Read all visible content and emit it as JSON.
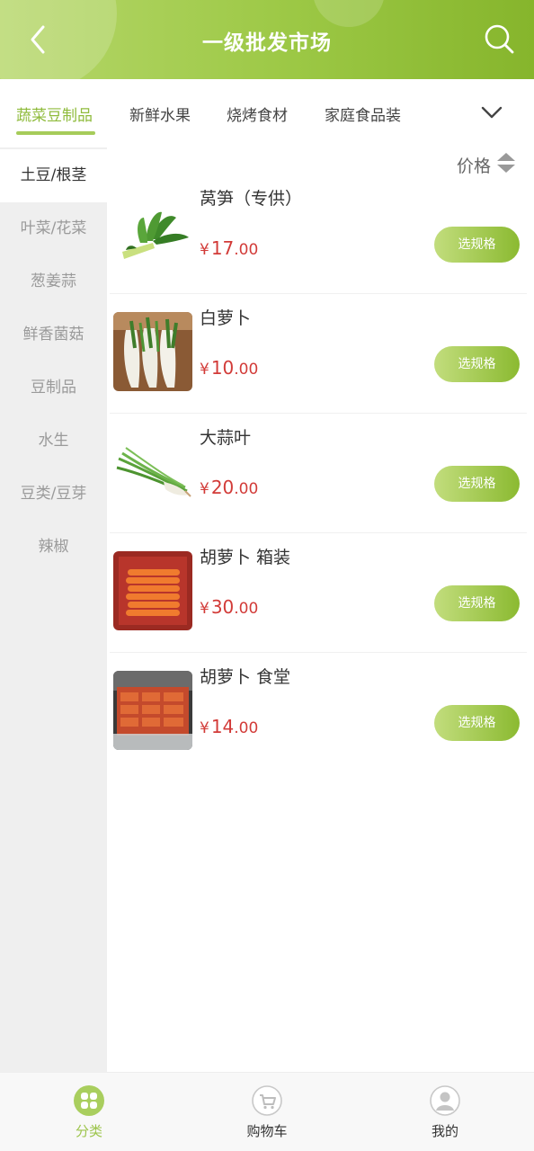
{
  "header": {
    "title": "一级批发市场"
  },
  "category_tabs": [
    {
      "label": "蔬菜豆制品",
      "active": true
    },
    {
      "label": "新鲜水果",
      "active": false
    },
    {
      "label": "烧烤食材",
      "active": false
    },
    {
      "label": "家庭食品装",
      "active": false
    }
  ],
  "sidebar": {
    "items": [
      {
        "label": "土豆/根茎",
        "active": true
      },
      {
        "label": "叶菜/花菜",
        "active": false
      },
      {
        "label": "葱姜蒜",
        "active": false
      },
      {
        "label": "鲜香菌菇",
        "active": false
      },
      {
        "label": "豆制品",
        "active": false
      },
      {
        "label": "水生",
        "active": false
      },
      {
        "label": "豆类/豆芽",
        "active": false
      },
      {
        "label": "辣椒",
        "active": false
      }
    ]
  },
  "sort": {
    "label": "价格"
  },
  "products": [
    {
      "name": "莴笋（专供）",
      "currency": "¥",
      "price_int": "17",
      "price_dec": ".00",
      "button": "选规格",
      "icon": "lettuce-stem-image"
    },
    {
      "name": "白萝卜",
      "currency": "¥",
      "price_int": "10",
      "price_dec": ".00",
      "button": "选规格",
      "icon": "white-radish-image"
    },
    {
      "name": "大蒜叶",
      "currency": "¥",
      "price_int": "20",
      "price_dec": ".00",
      "button": "选规格",
      "icon": "garlic-leaf-image"
    },
    {
      "name": "胡萝卜 箱装",
      "currency": "¥",
      "price_int": "30",
      "price_dec": ".00",
      "button": "选规格",
      "icon": "carrot-box-image"
    },
    {
      "name": "胡萝卜 食堂",
      "currency": "¥",
      "price_int": "14",
      "price_dec": ".00",
      "button": "选规格",
      "icon": "carrot-canteen-image"
    }
  ],
  "bottom_nav": [
    {
      "label": "分类",
      "active": true,
      "icon": "category-icon"
    },
    {
      "label": "购物车",
      "active": false,
      "icon": "cart-icon"
    },
    {
      "label": "我的",
      "active": false,
      "icon": "user-icon"
    }
  ],
  "colors": {
    "header_gradient_start": "#b6d76a",
    "header_gradient_end": "#86b52c",
    "accent": "#8fbb3c",
    "price": "#d23b38",
    "sidebar_bg": "#efefef"
  }
}
